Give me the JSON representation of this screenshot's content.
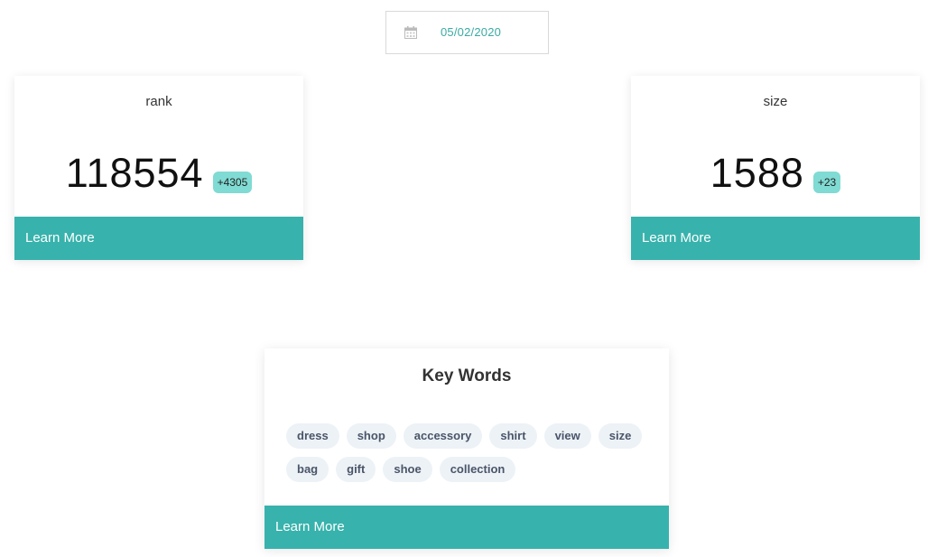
{
  "date_picker": {
    "icon": "calendar-icon",
    "value": "05/02/2020"
  },
  "cards": {
    "rank": {
      "title": "rank",
      "value": "118554",
      "delta": "+4305",
      "learn_more": "Learn More"
    },
    "size": {
      "title": "size",
      "value": "1588",
      "delta": "+23",
      "learn_more": "Learn More"
    }
  },
  "keywords": {
    "title": "Key Words",
    "tags": [
      "dress",
      "shop",
      "accessory",
      "shirt",
      "view",
      "size",
      "bag",
      "gift",
      "shoe",
      "collection"
    ],
    "learn_more": "Learn More"
  },
  "colors": {
    "accent": "#38b2ac",
    "badge": "#7fdbd3",
    "date_text": "#3aaaa4",
    "tag_bg": "#edf2f7"
  }
}
